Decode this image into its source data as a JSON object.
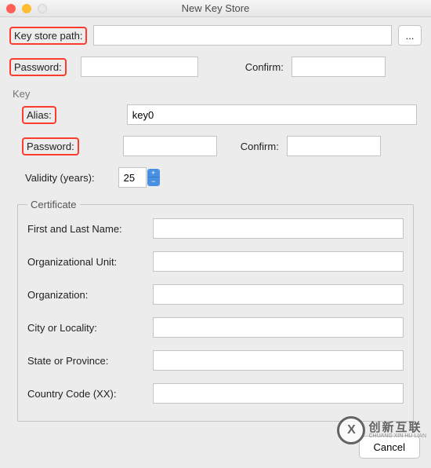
{
  "window": {
    "title": "New Key Store"
  },
  "labels": {
    "key_store_path": "Key store path:",
    "password": "Password:",
    "confirm": "Confirm:",
    "key_section": "Key",
    "alias": "Alias:",
    "validity": "Validity (years):",
    "certificate": "Certificate",
    "first_last": "First and Last Name:",
    "org_unit": "Organizational Unit:",
    "organization": "Organization:",
    "city": "City or Locality:",
    "state": "State or Province:",
    "country": "Country Code (XX):"
  },
  "values": {
    "key_store_path": "",
    "password": "",
    "confirm": "",
    "alias": "key0",
    "key_password": "",
    "key_confirm": "",
    "validity": "25",
    "first_last": "",
    "org_unit": "",
    "organization": "",
    "city": "",
    "state": "",
    "country": ""
  },
  "buttons": {
    "browse": "...",
    "cancel": "Cancel"
  },
  "watermark": {
    "logo": "X",
    "text": "创新互联",
    "sub": "CHUANG XIN HU LIAN"
  }
}
